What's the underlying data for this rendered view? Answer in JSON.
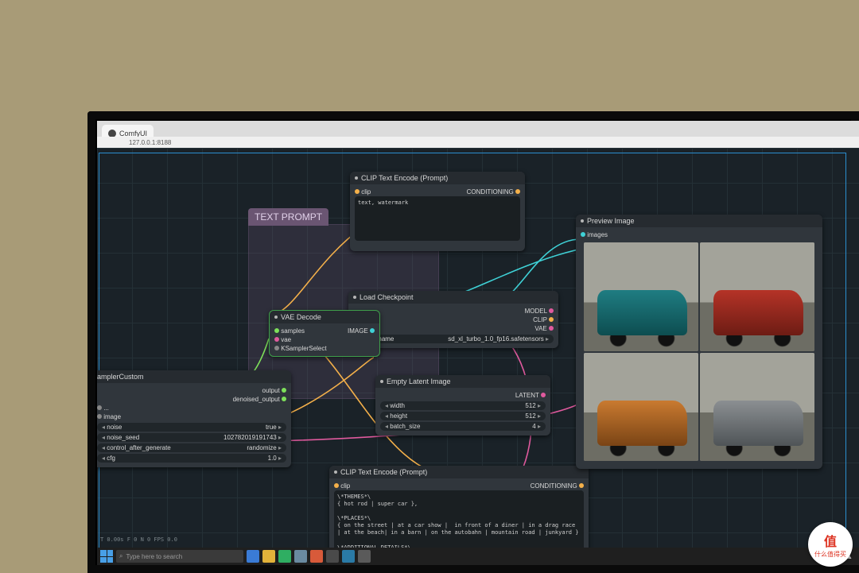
{
  "watermark": {
    "char": "值",
    "text": "什么值得买"
  },
  "browser": {
    "tab_title": "ComfyUI",
    "url": "127.0.0.1:8188"
  },
  "taskbar": {
    "search_placeholder": "Type here to search",
    "time": ""
  },
  "group": {
    "label": "TEXT PROMPT"
  },
  "stats": "T 0.00s\nF 0\nN 0\nFPS 0.0",
  "nodes": {
    "clip_neg": {
      "title": "CLIP Text Encode (Prompt)",
      "in_label": "clip",
      "out_label": "CONDITIONING",
      "text": "text, watermark"
    },
    "clip_pos": {
      "title": "CLIP Text Encode (Prompt)",
      "in_label": "clip",
      "out_label": "CONDITIONING",
      "text": "\\*THEMES*\\\n{ hot rod | super car },\n\n\\*PLACES*\\\n{ on the street | at a car show |  in front of a diner | in a drag race | at the beach| in a barn | on the autobahn | mountain road | junkyard }\n\n\\*ADDITIONAL DETAILS*\\"
    },
    "checkpoint": {
      "title": "Load Checkpoint",
      "out_model": "MODEL",
      "out_clip": "CLIP",
      "out_vae": "VAE",
      "field_label": "ckpt_name",
      "field_value": "sd_xl_turbo_1.0_fp16.safetensors"
    },
    "vae": {
      "title": "VAE Decode",
      "in_samples": "samples",
      "in_vae": "vae",
      "out_image": "IMAGE",
      "extra": "KSamplerSelect"
    },
    "latent": {
      "title": "Empty Latent Image",
      "out": "LATENT",
      "width_label": "width",
      "width_val": "512",
      "height_label": "height",
      "height_val": "512",
      "batch_label": "batch_size",
      "batch_val": "4"
    },
    "sampler": {
      "title": "amplerCustom",
      "out_output": "output",
      "out_denoised": "denoised_output",
      "rows": [
        {
          "l": "...",
          "v": ""
        },
        {
          "l": "image",
          "v": ""
        },
        {
          "l": "noise",
          "v": "true"
        },
        {
          "l": "noise_seed",
          "v": "102782019191743"
        },
        {
          "l": "control_after_generate",
          "v": "randomize"
        },
        {
          "l": "cfg",
          "v": "1.0"
        }
      ]
    },
    "preview": {
      "title": "Preview Image",
      "in_images": "images"
    }
  }
}
